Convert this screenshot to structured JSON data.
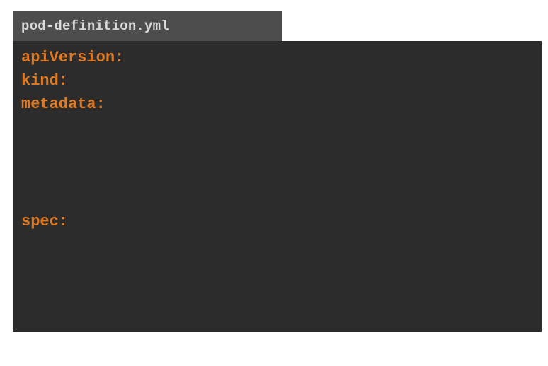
{
  "file_tab": {
    "filename": "pod-definition.yml"
  },
  "editor": {
    "lines": [
      "apiVersion:",
      "kind:",
      "metadata:",
      "spec:"
    ]
  },
  "colors": {
    "tab_background": "#4d4d4d",
    "tab_text": "#d9d9d9",
    "editor_background": "#2c2c2c",
    "yaml_key": "#e07b24"
  }
}
